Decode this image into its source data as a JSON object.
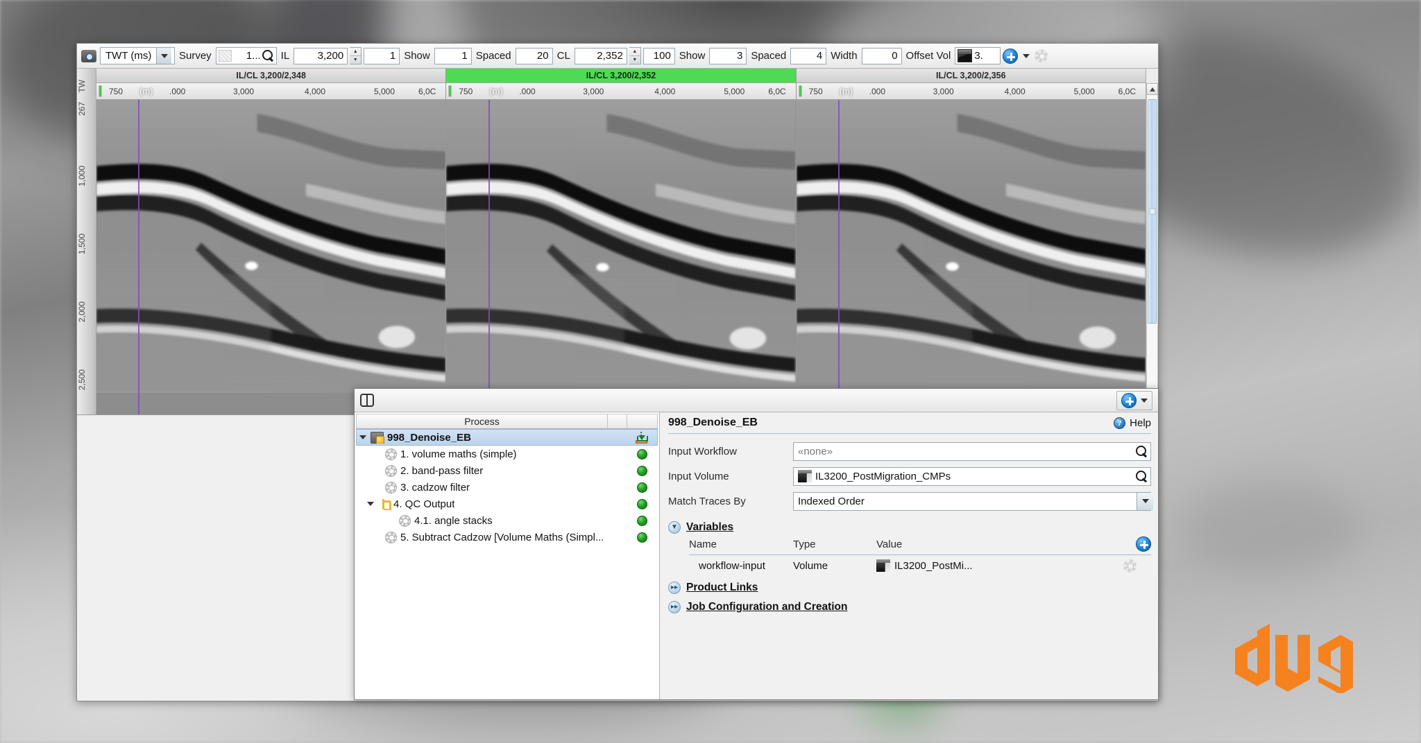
{
  "toolbar": {
    "camera_icon": "camera-icon",
    "domain_value": "TWT (ms)",
    "survey_label": "Survey",
    "survey_value": "1...",
    "il_label": "IL",
    "il_value": "3,200",
    "il_step": "1",
    "il_show_label": "Show",
    "il_show_value": "1",
    "il_spaced_label": "Spaced",
    "il_spaced_value": "20",
    "cl_label": "CL",
    "cl_value": "2,352",
    "cl_step": "100",
    "cl_show_label": "Show",
    "cl_show_value": "3",
    "cl_spaced_label": "Spaced",
    "cl_spaced_value": "4",
    "width_label": "Width",
    "width_value": "0",
    "offset_vol_label": "Offset Vol",
    "offset_vol_value": "3.",
    "add_icon": "add-icon",
    "gear_icon": "gear-icon"
  },
  "seismic": {
    "vertical_axis": {
      "name": "TW",
      "top_value": "267",
      "ticks": [
        "1,000",
        "1,500",
        "2,000",
        "2,500"
      ]
    },
    "panels": [
      {
        "title": "IL/CL 3,200/2,348",
        "active": false,
        "ruler": {
          "start": "750",
          "unit": "(m)",
          "ticks": [
            ".000",
            "3,000",
            "4,000",
            "5,000",
            "6,0C"
          ]
        }
      },
      {
        "title": "IL/CL 3,200/2,352",
        "active": true,
        "ruler": {
          "start": "750",
          "unit": "(m)",
          "ticks": [
            ".000",
            "3,000",
            "4,000",
            "5,000",
            "6,0C"
          ]
        }
      },
      {
        "title": "IL/CL 3,200/2,356",
        "active": false,
        "ruler": {
          "start": "750",
          "unit": "(m)",
          "ticks": [
            ".000",
            "3,000",
            "4,000",
            "5,000",
            "6,0C"
          ]
        }
      }
    ]
  },
  "workflow": {
    "toolbar": {
      "split_view_icon": "split-view-icon",
      "add_icon": "add-icon",
      "dropdown_icon": "chevron-down-icon"
    },
    "tree": {
      "column_header": "Process",
      "rows": [
        {
          "label": "998_Denoise_EB",
          "indent": 1,
          "icon": "workflow-icon",
          "twisty": true,
          "selected": true,
          "status": "download"
        },
        {
          "label": "1. volume maths (simple)",
          "indent": 2,
          "icon": "gear-icon",
          "twisty": false,
          "selected": false,
          "status": "green"
        },
        {
          "label": "2. band-pass filter",
          "indent": 2,
          "icon": "gear-icon",
          "twisty": false,
          "selected": false,
          "status": "green"
        },
        {
          "label": "3. cadzow filter",
          "indent": 2,
          "icon": "gear-icon",
          "twisty": false,
          "selected": false,
          "status": "green"
        },
        {
          "label": "4. QC Output",
          "indent": 2,
          "icon": "qc-fork-icon",
          "twisty": true,
          "selected": false,
          "status": "green"
        },
        {
          "label": "4.1. angle stacks",
          "indent": 3,
          "icon": "gear-icon",
          "twisty": false,
          "selected": false,
          "status": "green"
        },
        {
          "label": "5. Subtract Cadzow [Volume Maths (Simpl...",
          "indent": 2,
          "icon": "gear-icon",
          "twisty": false,
          "selected": false,
          "status": "green"
        }
      ]
    },
    "properties": {
      "title": "998_Denoise_EB",
      "help_label": "Help",
      "help_icon": "help-icon",
      "fields": [
        {
          "label": "Input Workflow",
          "value": "«none»",
          "placeholder": true,
          "control": "search",
          "icon": "search-icon"
        },
        {
          "label": "Input Volume",
          "value": "IL3200_PostMigration_CMPs",
          "placeholder": false,
          "control": "search-volume",
          "icon": "search-icon"
        },
        {
          "label": "Match Traces By",
          "value": "Indexed Order",
          "placeholder": false,
          "control": "dropdown",
          "icon": "chevron-down-icon"
        }
      ],
      "sections": [
        {
          "title": "Variables",
          "expanded": true,
          "toggle_icon": "chevron-down-circle-icon"
        },
        {
          "title": "Product Links",
          "expanded": false,
          "toggle_icon": "chevron-right-circle-icon"
        },
        {
          "title": "Job Configuration and Creation",
          "expanded": false,
          "toggle_icon": "chevron-right-circle-icon"
        }
      ],
      "variables": {
        "headers": {
          "name": "Name",
          "type": "Type",
          "value": "Value"
        },
        "add_icon": "add-icon",
        "rows": [
          {
            "name": "workflow-input",
            "type": "Volume",
            "value": "IL3200_PostMi...",
            "value_icon": "volume-cube-icon",
            "action_icon": "gear-icon"
          }
        ]
      }
    }
  },
  "branding": {
    "logo_text": "dug",
    "logo_color": "#F5821F"
  }
}
